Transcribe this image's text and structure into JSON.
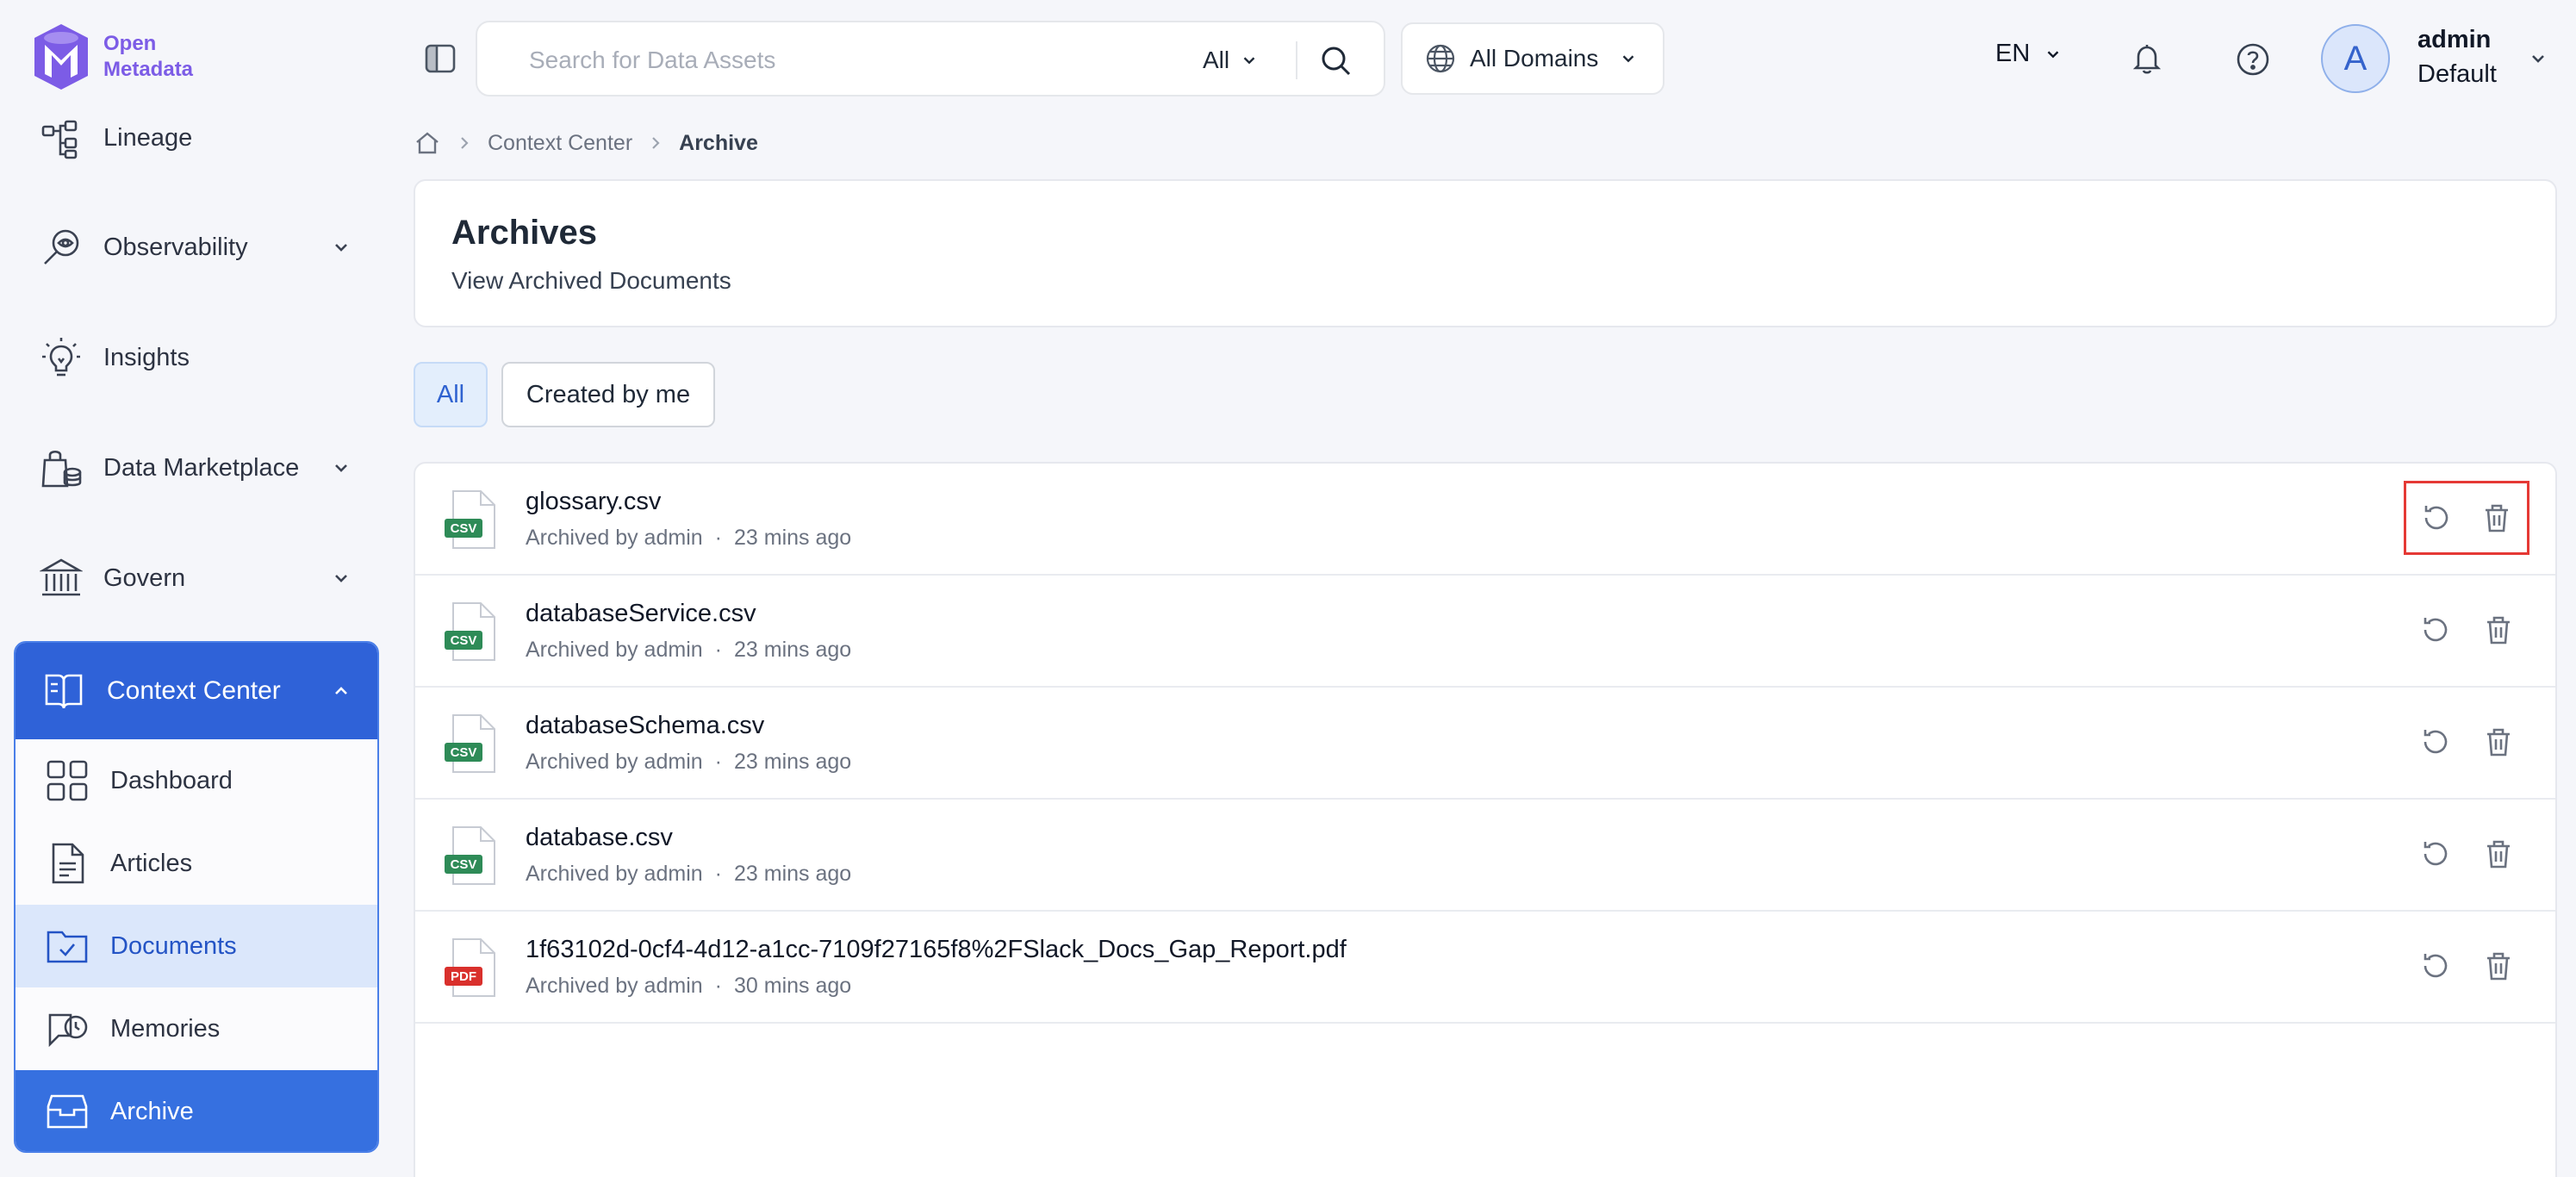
{
  "app": {
    "logo_line1": "Open",
    "logo_line2": "Metadata",
    "brand_color": "#7c5ce6",
    "accent_color": "#2f62d8"
  },
  "sidebar": {
    "items": [
      {
        "label": "Lineage",
        "icon": "lineage-icon",
        "has_chevron": false
      },
      {
        "label": "Observability",
        "icon": "observability-icon",
        "has_chevron": true
      },
      {
        "label": "Insights",
        "icon": "lightbulb-icon",
        "has_chevron": false
      },
      {
        "label": "Data Marketplace",
        "icon": "marketplace-icon",
        "has_chevron": true
      },
      {
        "label": "Govern",
        "icon": "bank-icon",
        "has_chevron": true
      }
    ],
    "context_center": {
      "label": "Context Center",
      "icon": "book-open-icon",
      "expanded": true,
      "children": [
        {
          "label": "Dashboard",
          "icon": "grid-icon"
        },
        {
          "label": "Articles",
          "icon": "document-icon"
        },
        {
          "label": "Documents",
          "icon": "folder-check-icon"
        },
        {
          "label": "Memories",
          "icon": "chat-clock-icon"
        },
        {
          "label": "Archive",
          "icon": "archive-icon"
        }
      ]
    }
  },
  "topbar": {
    "search_placeholder": "Search for Data Assets",
    "search_filter": "All",
    "domain_label": "All Domains",
    "language": "EN",
    "user": {
      "initial": "A",
      "name": "admin",
      "team": "Default"
    }
  },
  "breadcrumb": {
    "parent": "Context Center",
    "current": "Archive"
  },
  "page": {
    "title": "Archives",
    "subtitle": "View Archived Documents"
  },
  "filters": {
    "all": "All",
    "created_by_me": "Created by me",
    "active": "All"
  },
  "documents": [
    {
      "name": "glossary.csv",
      "type": "CSV",
      "archived_by": "Archived by admin",
      "time": "23 mins ago"
    },
    {
      "name": "databaseService.csv",
      "type": "CSV",
      "archived_by": "Archived by admin",
      "time": "23 mins ago"
    },
    {
      "name": "databaseSchema.csv",
      "type": "CSV",
      "archived_by": "Archived by admin",
      "time": "23 mins ago"
    },
    {
      "name": "database.csv",
      "type": "CSV",
      "archived_by": "Archived by admin",
      "time": "23 mins ago"
    },
    {
      "name": "1f63102d-0cf4-4d12-a1cc-7109f27165f8%2FSlack_Docs_Gap_Report.pdf",
      "type": "PDF",
      "archived_by": "Archived by admin",
      "time": "30 mins ago"
    }
  ],
  "colors": {
    "csv_badge": "#2e8b57",
    "pdf_badge": "#d9302c",
    "highlight_border": "#e53935"
  }
}
